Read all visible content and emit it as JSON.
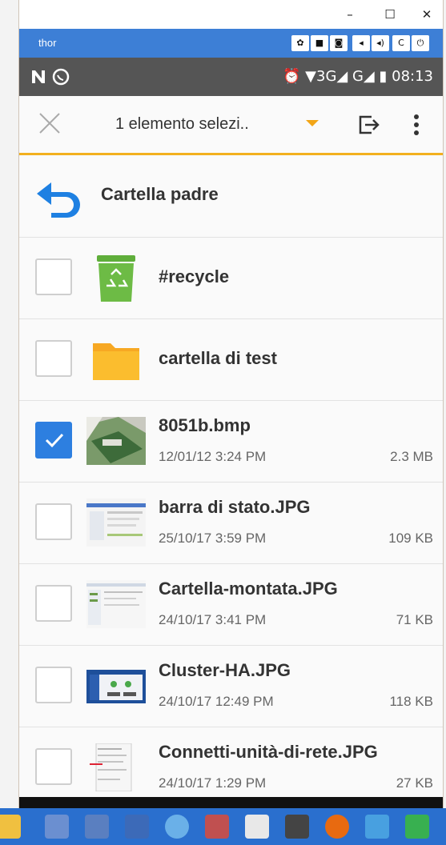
{
  "window": {
    "minimize_glyph": "–",
    "maximize_glyph": "☐",
    "close_glyph": "✕"
  },
  "emulator": {
    "title": "thor",
    "buttons": [
      "✿",
      "■",
      "◙",
      "◂",
      "◂)",
      "C",
      "⏻"
    ]
  },
  "status_bar": {
    "left_icons": [
      "notification-n-icon",
      "whatsapp-icon"
    ],
    "right_text": "⏰ ▼3G◢ G◢ ▮ 08:13",
    "time": "08:13"
  },
  "toolbar": {
    "title": "1 elemento selezi..",
    "accent_color": "#f2b01e"
  },
  "parent": {
    "label": "Cartella padre"
  },
  "items": [
    {
      "name": "#recycle",
      "type": "recycle",
      "checked": false,
      "date": "",
      "size": ""
    },
    {
      "name": "cartella di test",
      "type": "folder",
      "checked": false,
      "date": "",
      "size": ""
    },
    {
      "name": "8051b.bmp",
      "type": "image",
      "checked": true,
      "date": "12/01/12 3:24 PM",
      "size": "2.3 MB"
    },
    {
      "name": "barra di stato.JPG",
      "type": "image",
      "checked": false,
      "date": "25/10/17 3:59 PM",
      "size": "109 KB"
    },
    {
      "name": "Cartella-montata.JPG",
      "type": "image",
      "checked": false,
      "date": "24/10/17 3:41 PM",
      "size": "71 KB"
    },
    {
      "name": "Cluster-HA.JPG",
      "type": "image",
      "checked": false,
      "date": "24/10/17 12:49 PM",
      "size": "118 KB"
    },
    {
      "name": "Connetti-unità-di-rete.JPG",
      "type": "image",
      "checked": false,
      "date": "24/10/17 1:29 PM",
      "size": "27 KB"
    }
  ],
  "colors": {
    "selected_checkbox": "#2d7fe0",
    "folder": "#f7a823",
    "recycle": "#6dbb45",
    "taskbar": "#2a6fce"
  }
}
